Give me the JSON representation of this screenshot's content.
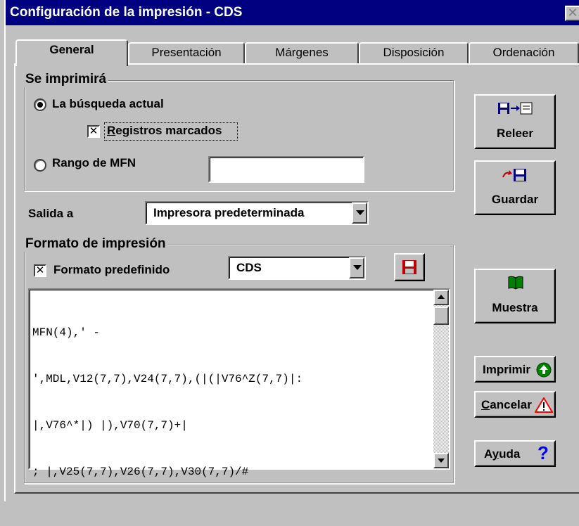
{
  "window": {
    "title": "Configuración de la impresión - CDS",
    "close_symbol": "✕"
  },
  "tabs": [
    {
      "label": "General",
      "active": true
    },
    {
      "label": "Presentación",
      "active": false
    },
    {
      "label": "Márgenes",
      "active": false
    },
    {
      "label": "Disposición",
      "active": false
    },
    {
      "label": "Ordenación",
      "active": false
    }
  ],
  "print_group": {
    "legend": "Se imprimirá",
    "radio_current": {
      "label": "La búsqueda actual",
      "selected": true
    },
    "marked_records": {
      "label_prefix": "R",
      "label_rest": "egistros marcados",
      "checked": true,
      "mark": "✕"
    },
    "radio_range": {
      "label": "Rango de MFN",
      "selected": false,
      "value": ""
    }
  },
  "output": {
    "label": "Salida a",
    "selected": "Impresora predeterminada"
  },
  "format_group": {
    "legend": "Formato de impresión",
    "predefined": {
      "label": "Formato predefinido",
      "checked": true,
      "mark": "✕"
    },
    "format_select": "CDS",
    "save_icon": "floppy-disk-icon",
    "code_lines": [
      "MFN(4),' -",
      "',MDL,V12(7,7),V24(7,7),(|(|V76^Z(7,7)|:",
      "|,V76^*|) |),V70(7,7)+|",
      "; |,V25(7,7),V26(7,7),V30(7,7)/#"
    ]
  },
  "buttons": {
    "reload": {
      "label": "Releer",
      "icon": "reload-icon"
    },
    "save": {
      "label": "Guardar",
      "icon": "save-icon"
    },
    "preview": {
      "label": "Muestra",
      "icon": "book-icon"
    },
    "print": {
      "label": "Imprimir",
      "icon": "green-arrow-icon"
    },
    "cancel": {
      "label_prefix": "C",
      "label_rest": "ancelar",
      "icon": "warning-icon"
    },
    "help": {
      "label_a": "A",
      "label_u": "y",
      "label_rest": "uda",
      "icon": "question-icon",
      "symbol": "?"
    }
  },
  "colors": {
    "titlebar": "#000080",
    "face": "#c0c0c0",
    "print_icon": "#008000",
    "warning": "#ff0000",
    "help": "#0000ff"
  }
}
